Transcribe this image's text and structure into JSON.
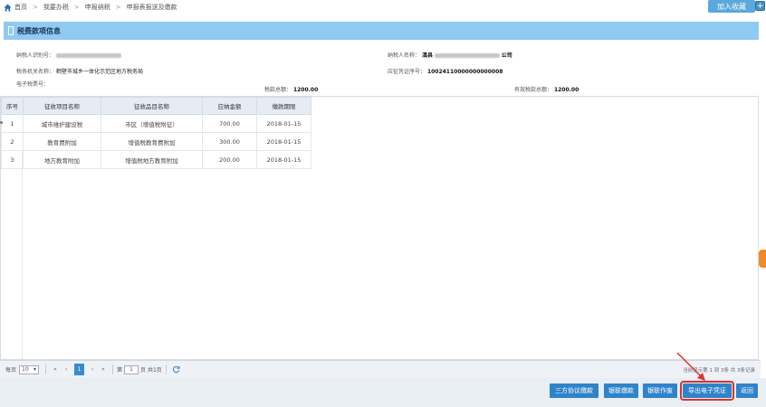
{
  "breadcrumb": [
    "首页",
    "我要办税",
    "申报纳税",
    "申报表报送及缴款"
  ],
  "join_label": "加入收藏",
  "section_title": "税费款项信息",
  "info": {
    "taxpayer_id_label": "纳税人识别号：",
    "taxpayer_name_label": "纳税人名称：",
    "taxpayer_name_prefix": "滇县",
    "taxpayer_name_suffix": "公司",
    "tax_office_label": "税务机关名称：",
    "tax_office_value": "鹤壁市城乡一体化示范区地方税务局",
    "voucher_label": "应征凭证序号：",
    "voucher_value": "10024110000000000008",
    "ticket_label": "电子税票号：",
    "total_label": "税款总额：",
    "total_value": "1200.00",
    "valid_total_label": "有效税款总额：",
    "valid_total_value": "1200.00"
  },
  "table": {
    "headers": [
      "序号",
      "征收项目名称",
      "征收品目名称",
      "应纳金额",
      "缴款期限"
    ],
    "rows": [
      [
        "1",
        "城市维护建设税",
        "市区（增值税附征）",
        "700.00",
        "2018-01-15"
      ],
      [
        "2",
        "教育费附加",
        "增值税教育费附加",
        "300.00",
        "2018-01-15"
      ],
      [
        "3",
        "地方教育附加",
        "增值税地方教育附加",
        "200.00",
        "2018-01-15"
      ]
    ]
  },
  "pager": {
    "per_page_label": "每页",
    "per_page_value": "10",
    "first": "«",
    "prev": "‹",
    "current": "1",
    "next": "›",
    "last": "»",
    "page_prefix": "第",
    "page_input": "1",
    "page_suffix": "页 共1页",
    "summary": "当前显示第 1 到 3条 共 3条记录"
  },
  "buttons": {
    "three_party": "三方协议缴款",
    "bank_card": "银联缴款",
    "bank_voucher": "银联作废",
    "export": "导出电子凭证",
    "back": "返回"
  },
  "colors": {
    "header_bar": "#8ecaf2",
    "button": "#2f83c9",
    "highlight": "#e0302a"
  }
}
